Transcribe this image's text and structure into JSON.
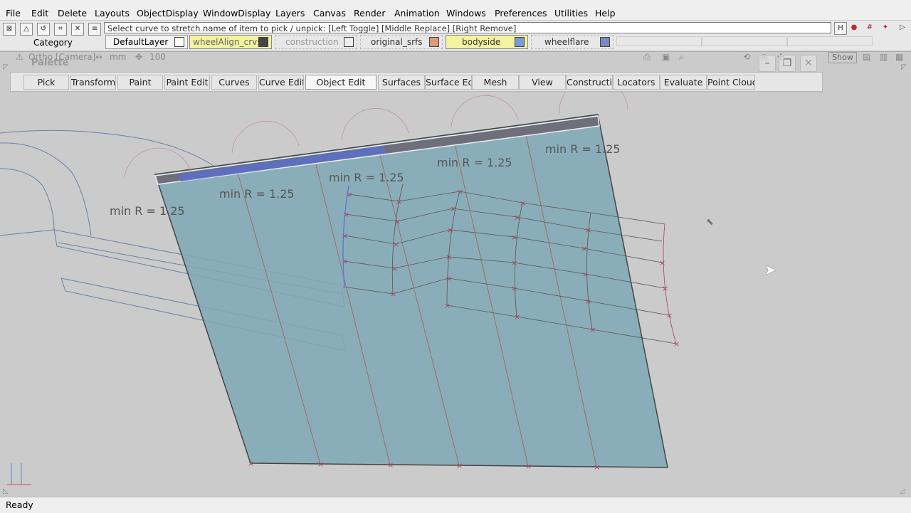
{
  "menu": [
    "File",
    "Edit",
    "Delete",
    "Layouts",
    "ObjectDisplay",
    "WindowDisplay",
    "Layers",
    "Canvas",
    "Render",
    "Animation",
    "Windows",
    "Preferences",
    "Utilities",
    "Help"
  ],
  "toolbar": {
    "prompt": "Select curve to stretch name of item to pick / unpick: [Left Toggle] [Middle Replace] [Right Remove]",
    "category_label": "Category"
  },
  "layers": [
    {
      "name": "DefaultLayer",
      "color": "#ffffff"
    },
    {
      "name": "wheelAlign_crvs",
      "color": "#555555"
    },
    {
      "name": "construction",
      "color": "#e0e0e0"
    },
    {
      "name": "original_srfs",
      "color": "#d99a7a"
    },
    {
      "name": "bodyside",
      "color": "#7a9ad9"
    },
    {
      "name": "wheelflare",
      "color": "#7a8ac0"
    }
  ],
  "viewport": {
    "camera_label": "Ortho [Camera]",
    "units": "mm",
    "zoom": "100",
    "palette_title": "Palette",
    "show_button": "Show",
    "annotations": [
      "min R = 1.25",
      "min R = 1.25",
      "min R = 1.25",
      "min R = 1.25",
      "min R = 1.25"
    ]
  },
  "palette_tabs": [
    "Pick",
    "Transform",
    "Paint",
    "Paint Edit",
    "Curves",
    "Curve Edit",
    "Object Edit",
    "Surfaces",
    "Surface Edi",
    "Mesh",
    "View",
    "Construction",
    "Locators",
    "Evaluate",
    "Point Clouds"
  ],
  "status": {
    "text": "Ready"
  },
  "colors": {
    "surface": "#7aa7b5",
    "curve_blue": "#5a7fd0",
    "cv_red": "#b0405a",
    "handle_green": "#50d0a0"
  }
}
